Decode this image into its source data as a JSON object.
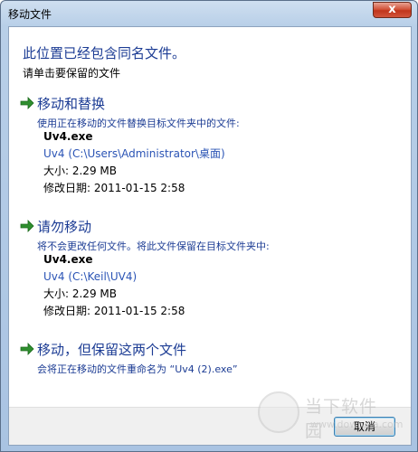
{
  "window": {
    "title": "移动文件",
    "close_label": "x"
  },
  "dialog": {
    "heading": "此位置已经包含同名文件。",
    "subheading": "请单击要保留的文件"
  },
  "options": [
    {
      "title": "移动和替换",
      "description": "使用正在移动的文件替换目标文件夹中的文件:",
      "file": {
        "name": "Uv4.exe",
        "path": "Uv4 (C:\\Users\\Administrator\\桌面)",
        "size": "大小: 2.29 MB",
        "modified": "修改日期: 2011-01-15  2:58"
      }
    },
    {
      "title": "请勿移动",
      "description": "将不会更改任何文件。将此文件保留在目标文件夹中:",
      "file": {
        "name": "Uv4.exe",
        "path": "Uv4 (C:\\Keil\\UV4)",
        "size": "大小: 2.29 MB",
        "modified": "修改日期: 2011-01-15  2:58"
      }
    },
    {
      "title": "移动，但保留这两个文件",
      "description": "会将正在移动的文件重命名为 “Uv4 (2).exe”"
    }
  ],
  "footer": {
    "cancel_label": "取消"
  },
  "watermark": {
    "text": "当下软件园",
    "url": "www.downxia.com"
  },
  "colors": {
    "link_blue": "#1c3c94",
    "arrow_green": "#2f8f2f"
  }
}
